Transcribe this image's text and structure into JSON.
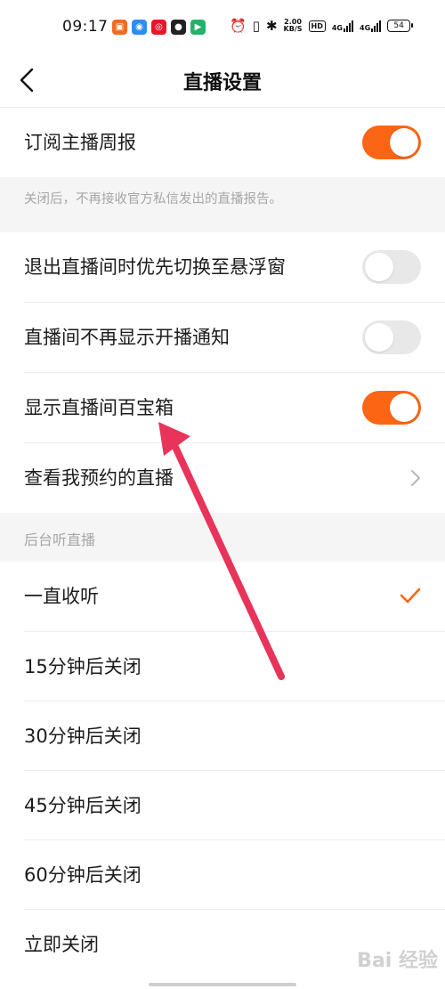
{
  "status_bar": {
    "time": "09:17",
    "network_speed_top": "2.00",
    "network_speed_unit": "KB/S",
    "hd_badge": "HD",
    "signal_1_label": "4G",
    "signal_2_label": "4G",
    "battery": "54",
    "app_icons": [
      "app-icon-1",
      "app-icon-2",
      "weibo-icon",
      "app-icon-4",
      "app-icon-5"
    ]
  },
  "header": {
    "title": "直播设置",
    "back_icon": "chevron-left-icon"
  },
  "settings": {
    "weekly_report": {
      "label": "订阅主播周报",
      "enabled": true
    },
    "weekly_report_hint": "关闭后，不再接收官方私信发出的直播报告。",
    "floating_window": {
      "label": "退出直播间时优先切换至悬浮窗",
      "enabled": false
    },
    "hide_notice": {
      "label": "直播间不再显示开播通知",
      "enabled": false
    },
    "treasure_box": {
      "label": "显示直播间百宝箱",
      "enabled": true
    },
    "my_reservations": {
      "label": "查看我预约的直播"
    }
  },
  "background_listen": {
    "section_title": "后台听直播",
    "options": [
      {
        "label": "一直收听",
        "selected": true
      },
      {
        "label": "15分钟后关闭",
        "selected": false
      },
      {
        "label": "30分钟后关闭",
        "selected": false
      },
      {
        "label": "45分钟后关闭",
        "selected": false
      },
      {
        "label": "60分钟后关闭",
        "selected": false
      },
      {
        "label": "立即关闭",
        "selected": false
      }
    ]
  },
  "colors": {
    "accent": "#fb6514",
    "annotation_arrow": "#e8335a"
  },
  "watermark": "Bai 经验"
}
